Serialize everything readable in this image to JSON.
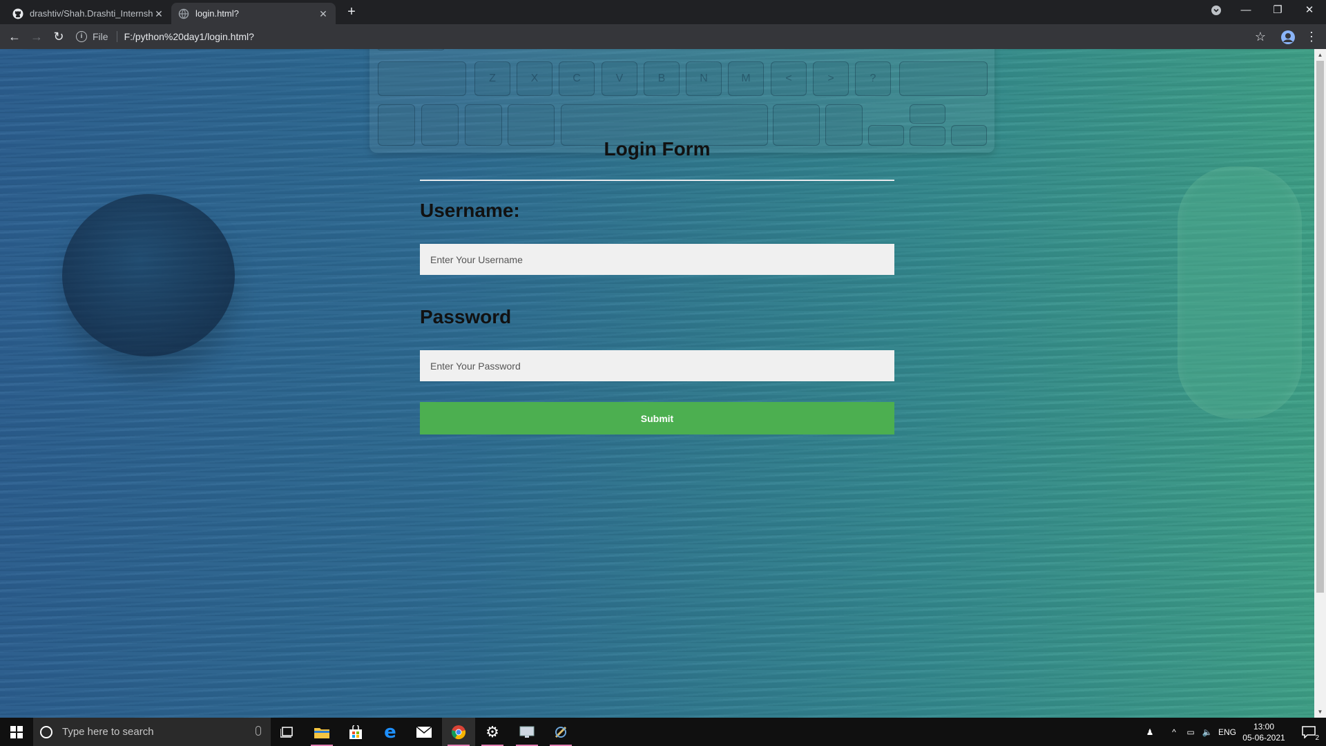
{
  "browser": {
    "tabs": [
      {
        "title": "drashtiv/Shah.Drashti_Internship",
        "icon": "github-icon",
        "active": false
      },
      {
        "title": "login.html?",
        "icon": "globe-icon",
        "active": true
      }
    ],
    "address": {
      "scheme_label": "File",
      "url": "F:/python%20day1/login.html?"
    }
  },
  "page": {
    "form": {
      "title": "Login Form",
      "username_label": "Username:",
      "username_placeholder": "Enter Your Username",
      "password_label": "Password",
      "password_placeholder": "Enter Your Password",
      "submit_label": "Submit"
    },
    "background_keys": [
      "Z",
      "X",
      "C",
      "V",
      "B",
      "N",
      "M",
      "<",
      ">",
      "?"
    ]
  },
  "taskbar": {
    "search_placeholder": "Type here to search",
    "language": "ENG",
    "time": "13:00",
    "date": "05-06-2021",
    "notification_count": "2"
  },
  "colors": {
    "submit_button": "#4caf50",
    "input_background": "#f0f0f0",
    "background_left": "#2b5f90",
    "background_right": "#3fa287"
  }
}
